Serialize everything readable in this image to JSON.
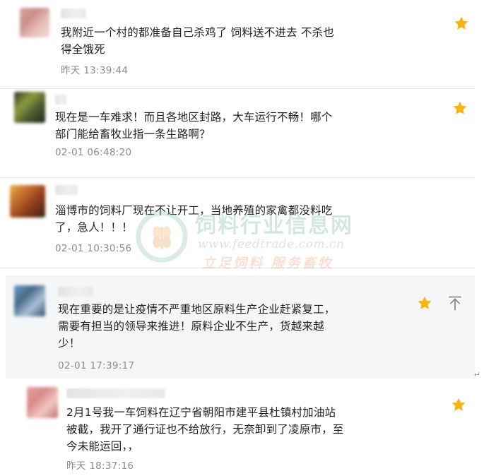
{
  "comments": [
    {
      "text": "我附近一个村的都准备自己杀鸡了 饲料送不进去 不杀也\n得全饿死",
      "time": "昨天 13:39:44",
      "avatar_colors": [
        "#d9a7a0",
        "#c98f8a",
        "#e6c0b8",
        "#f0d8d0"
      ]
    },
    {
      "text": "现在是一车难求！而且各地区封路，大车运行不畅！哪个\n部门能给畜牧业指一条生路啊？",
      "time": "02-01 06:48:20",
      "avatar_colors": [
        "#2f3a26",
        "#8c9a3c",
        "#4a5a30",
        "#1e261a"
      ]
    },
    {
      "text": "淄博市的饲料厂现在不让开工，当地养殖的家禽都没料吃\n了，急人！！！",
      "time": "02-01 10:30:56",
      "avatar_colors": [
        "#e8b04a",
        "#c0682a",
        "#8a3a1a",
        "#3a2418"
      ]
    },
    {
      "text": "现在重要的是让疫情不严重地区原料生产企业赶紧复工，\n需要有担当的领导来推进！原料企业不生产，货越来越\n少！",
      "time": "02-01 17:39:17",
      "avatar_colors": [
        "#6a9ac8",
        "#4a6a8a",
        "#a8c0d8",
        "#3a5068"
      ]
    },
    {
      "text": "2月1号我一车饲料在辽宁省朝阳市建平县杜镇村加油站\n被截，我开了通行证也不给放行，无奈卸到了凌原市，至\n今未能运回，，",
      "time": "昨天 18:37:16",
      "avatar_colors": [
        "#e8a0a0",
        "#d88a8a",
        "#f0c8c0",
        "#c07070"
      ]
    }
  ],
  "icons": {
    "star": "star-icon",
    "pin": "pin-to-top-icon"
  },
  "colors": {
    "star": "#f5b316",
    "pin": "#8a8a8a",
    "alt_background": "#f5f6f7"
  },
  "watermark": {
    "title": "饲料行业信息网",
    "url": "www.feedtrade.com.cn",
    "slogan": "立足饲料  服务畜牧"
  },
  "enter_mark": "↵"
}
